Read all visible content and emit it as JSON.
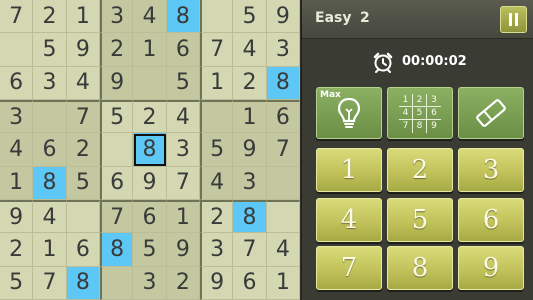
{
  "header": {
    "difficulty": "Easy",
    "level": "2"
  },
  "timer": {
    "value": "00:00:02"
  },
  "tools": {
    "max_label": "Max",
    "notes_grid": [
      "1",
      "2",
      "3",
      "4",
      "5",
      "6",
      "7",
      "8",
      "9"
    ]
  },
  "keypad": [
    "1",
    "2",
    "3",
    "4",
    "5",
    "6",
    "7",
    "8",
    "9"
  ],
  "board": {
    "cells": [
      [
        "7",
        "2",
        "1",
        "3",
        "4",
        "8",
        "",
        "5",
        "9"
      ],
      [
        "",
        "5",
        "9",
        "2",
        "1",
        "6",
        "7",
        "4",
        "3"
      ],
      [
        "6",
        "3",
        "4",
        "9",
        "",
        "5",
        "1",
        "2",
        "8"
      ],
      [
        "3",
        "",
        "7",
        "5",
        "2",
        "4",
        "",
        "1",
        "6"
      ],
      [
        "4",
        "6",
        "2",
        "",
        "8",
        "3",
        "5",
        "9",
        "7"
      ],
      [
        "1",
        "8",
        "5",
        "6",
        "9",
        "7",
        "4",
        "3",
        ""
      ],
      [
        "9",
        "4",
        "",
        "7",
        "6",
        "1",
        "2",
        "8",
        ""
      ],
      [
        "2",
        "1",
        "6",
        "8",
        "5",
        "9",
        "3",
        "7",
        "4"
      ],
      [
        "5",
        "7",
        "8",
        "",
        "3",
        "2",
        "9",
        "6",
        "1"
      ]
    ],
    "highlighted": [
      [
        0,
        5
      ],
      [
        2,
        8
      ],
      [
        4,
        4
      ],
      [
        5,
        1
      ],
      [
        6,
        7
      ],
      [
        7,
        3
      ],
      [
        8,
        2
      ]
    ],
    "selected": [
      4,
      4
    ]
  },
  "colors": {
    "highlight": "#5dc7f5",
    "board": "#d3d8b2",
    "panel": "#3a3b33",
    "keypad": "#c1c25a",
    "tool": "#6a8f45"
  }
}
